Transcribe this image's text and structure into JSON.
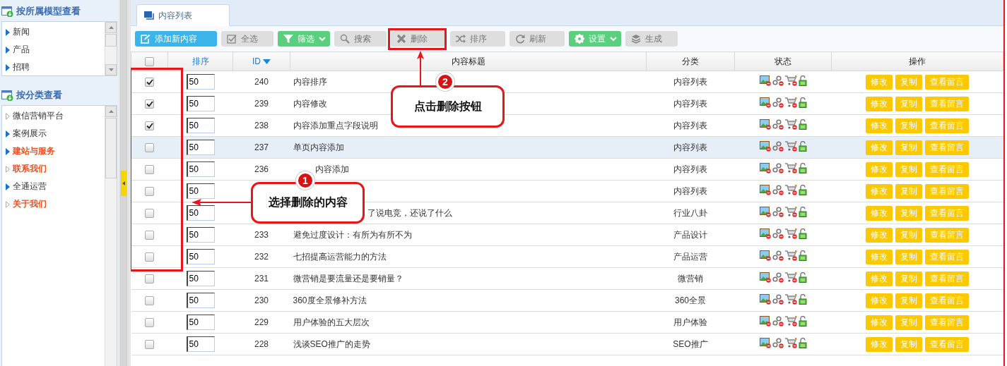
{
  "sidebar": {
    "sections": [
      {
        "title": "按所属模型查看",
        "items": [
          {
            "label": "新闻",
            "kind": "branch",
            "highlighted": false
          },
          {
            "label": "产品",
            "kind": "branch",
            "highlighted": false
          },
          {
            "label": "招聘",
            "kind": "branch",
            "highlighted": false
          }
        ]
      },
      {
        "title": "按分类查看",
        "items": [
          {
            "label": "微信营销平台",
            "kind": "leaf",
            "highlighted": false
          },
          {
            "label": "案例展示",
            "kind": "branch",
            "highlighted": false
          },
          {
            "label": "建站与服务",
            "kind": "branch",
            "highlighted": true
          },
          {
            "label": "联系我们",
            "kind": "leaf",
            "highlighted": true
          },
          {
            "label": "全通运营",
            "kind": "branch",
            "highlighted": false
          },
          {
            "label": "关于我们",
            "kind": "leaf",
            "highlighted": true
          }
        ]
      }
    ]
  },
  "tab": {
    "label": "内容列表",
    "selected": true
  },
  "toolbar": [
    {
      "label": "添加新内容",
      "dropdown": false
    },
    {
      "label": "全选",
      "dropdown": false
    },
    {
      "label": "筛选",
      "dropdown": true
    },
    {
      "label": "搜索",
      "dropdown": false
    },
    {
      "label": "删除",
      "dropdown": false
    },
    {
      "label": "排序",
      "dropdown": false
    },
    {
      "label": "刷新",
      "dropdown": false
    },
    {
      "label": "设置",
      "dropdown": true
    },
    {
      "label": "生成",
      "dropdown": false
    }
  ],
  "table": {
    "header_checkbox": {
      "checked": false
    },
    "columns": [
      {
        "label": "排序",
        "link": true,
        "sorted": false
      },
      {
        "label": "ID",
        "link": true,
        "sorted": true
      },
      {
        "label": "内容标题",
        "link": false,
        "sorted": false
      },
      {
        "label": "分类",
        "link": false,
        "sorted": false
      },
      {
        "label": "状态",
        "link": false,
        "sorted": false
      },
      {
        "label": "操作",
        "link": false,
        "sorted": false
      }
    ],
    "rows": [
      {
        "checked": true,
        "selected": false,
        "order": "50",
        "id": "240",
        "title": "内容排序",
        "category": "内容列表",
        "actions": [
          "修改",
          "复制",
          "查看留言"
        ]
      },
      {
        "checked": true,
        "selected": false,
        "order": "50",
        "id": "239",
        "title": "内容修改",
        "category": "内容列表",
        "actions": [
          "修改",
          "复制",
          "查看留言"
        ]
      },
      {
        "checked": true,
        "selected": false,
        "order": "50",
        "id": "238",
        "title": "内容添加重点字段说明",
        "category": "内容列表",
        "actions": [
          "修改",
          "复制",
          "查看留言"
        ]
      },
      {
        "checked": false,
        "selected": true,
        "order": "50",
        "id": "237",
        "title": "单页内容添加",
        "category": "内容列表",
        "actions": [
          "修改",
          "复制",
          "查看留言"
        ]
      },
      {
        "checked": false,
        "selected": false,
        "order": "50",
        "id": "236",
        "title": "内容添加",
        "category": "内容列表",
        "actions": [
          "修改",
          "复制",
          "查看留言"
        ]
      },
      {
        "checked": false,
        "selected": false,
        "order": "50",
        "category": "内容列表",
        "actions": [
          "修改",
          "复制",
          "查看留言"
        ]
      },
      {
        "checked": false,
        "selected": false,
        "order": "50",
        "title": "了说电竞，还说了什么",
        "category": "行业八卦",
        "actions": [
          "修改",
          "复制",
          "查看留言"
        ]
      },
      {
        "checked": false,
        "selected": false,
        "order": "50",
        "id": "233",
        "title": "避免过度设计：有所为有所不为",
        "category": "产品设计",
        "actions": [
          "修改",
          "复制",
          "查看留言"
        ]
      },
      {
        "checked": false,
        "selected": false,
        "order": "50",
        "id": "232",
        "title": "七招提高运营能力的方法",
        "category": "产品运营",
        "actions": [
          "修改",
          "复制",
          "查看留言"
        ]
      },
      {
        "checked": false,
        "selected": false,
        "order": "50",
        "id": "231",
        "title": "微营销是要流量还是要销量？",
        "category": "微营销",
        "actions": [
          "修改",
          "复制",
          "查看留言"
        ]
      },
      {
        "checked": false,
        "selected": false,
        "order": "50",
        "id": "230",
        "title": "360度全景修补方法",
        "category": "360全景",
        "actions": [
          "修改",
          "复制",
          "查看留言"
        ]
      },
      {
        "checked": false,
        "selected": false,
        "order": "50",
        "id": "229",
        "title": "用户体验的五大层次",
        "category": "用户体验",
        "actions": [
          "修改",
          "复制",
          "查看留言"
        ]
      },
      {
        "checked": false,
        "selected": false,
        "order": "50",
        "id": "228",
        "title": "浅谈SEO推广的走势",
        "category": "SEO推广",
        "actions": [
          "修改",
          "复制",
          "查看留言"
        ]
      }
    ]
  },
  "annotations": [
    {
      "number": "1",
      "text": "选择删除的内容"
    },
    {
      "number": "2",
      "text": "点击删除按钮"
    }
  ]
}
